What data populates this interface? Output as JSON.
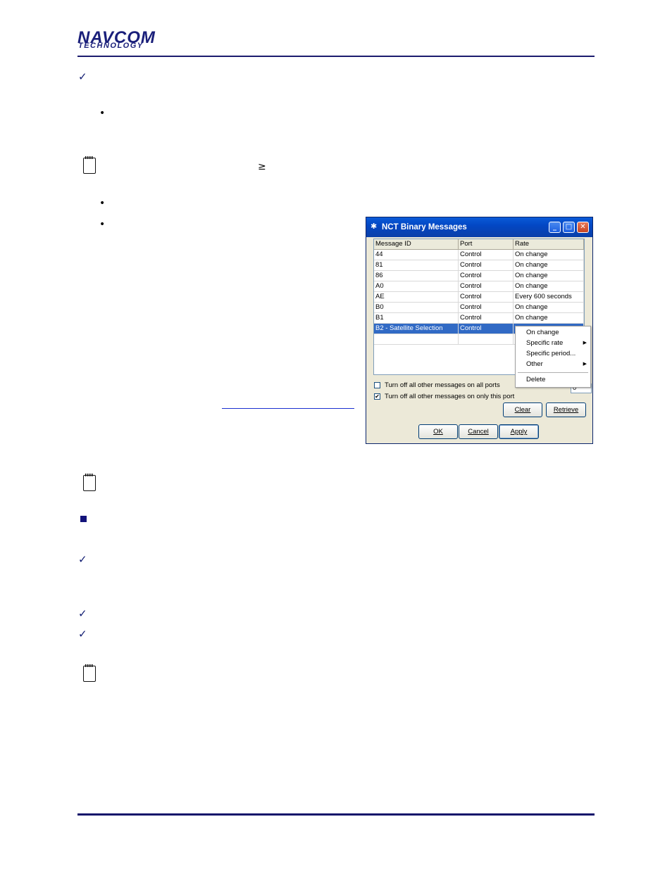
{
  "header": {
    "logo_line1": "NAVCOM",
    "logo_line2": "TECHNOLOGY"
  },
  "symbols": {
    "check": "✓",
    "bullet": "•",
    "geq": "≥"
  },
  "dialog": {
    "title": "NCT Binary Messages",
    "columns": [
      "Message ID",
      "Port",
      "Rate"
    ],
    "rows": [
      [
        "44",
        "Control",
        "On change"
      ],
      [
        "81",
        "Control",
        "On change"
      ],
      [
        "86",
        "Control",
        "On change"
      ],
      [
        "A0",
        "Control",
        "On change"
      ],
      [
        "AE",
        "Control",
        "Every 600 seconds"
      ],
      [
        "B0",
        "Control",
        "On change"
      ],
      [
        "B1",
        "Control",
        "On change"
      ],
      [
        "B2 - Satellite Selection",
        "Control",
        ""
      ]
    ],
    "context_menu": {
      "items": [
        "On change",
        "Specific rate",
        "Specific period...",
        "Other",
        "Delete"
      ],
      "submenu_arrow": "▶"
    },
    "spin_value": "0",
    "checkbox_all_ports": "Turn off all other messages on all ports",
    "checkbox_this_port": "Turn off all other messages on only this port",
    "checkbox_this_port_checked": "✔",
    "buttons": {
      "clear": "Clear",
      "retrieve": "Retrieve",
      "ok": "OK",
      "cancel": "Cancel",
      "apply": "Apply"
    },
    "title_buttons": {
      "minimize": "_",
      "maximize": "□",
      "close": "✕"
    }
  },
  "colors": {
    "brand": "#1a1f7a",
    "rule": "#10106a",
    "selection": "#316ac5"
  }
}
